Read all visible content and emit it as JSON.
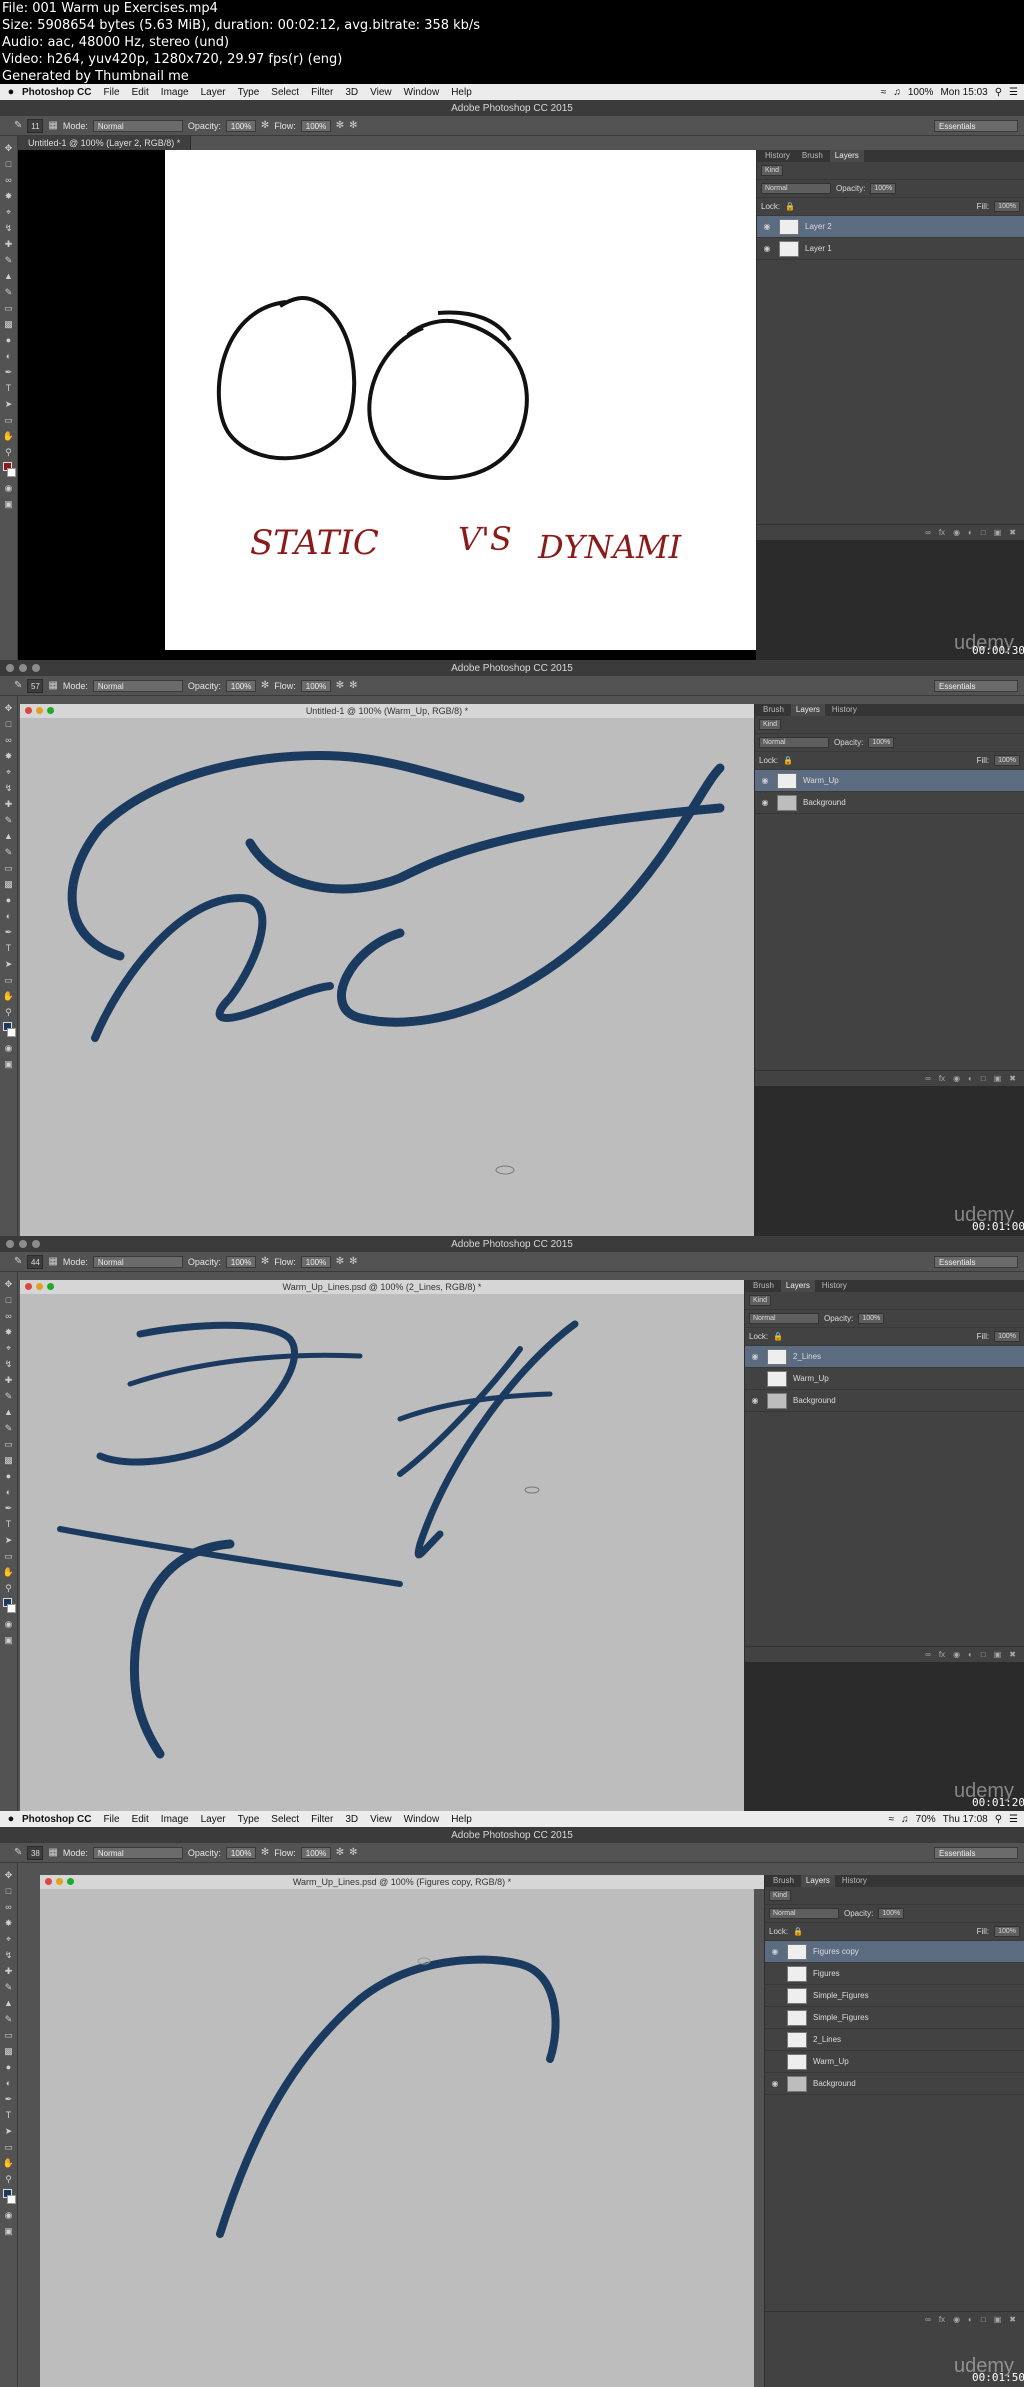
{
  "meta": {
    "file": "File: 001 Warm up Exercises.mp4",
    "size": "Size: 5908654 bytes (5.63 MiB), duration: 00:02:12, avg.bitrate: 358 kb/s",
    "audio": "Audio: aac, 48000 Hz, stereo (und)",
    "video": "Video: h264, yuv420p, 1280x720, 29.97 fps(r) (eng)",
    "generated": "Generated by Thumbnail me"
  },
  "menubar": {
    "app": "Photoshop CC",
    "items": [
      "File",
      "Edit",
      "Image",
      "Layer",
      "Type",
      "Select",
      "Filter",
      "3D",
      "View",
      "Window",
      "Help"
    ],
    "battery1": "100%",
    "clock1": "Mon 15:03",
    "battery4": "70%",
    "clock4": "Thu 17:08"
  },
  "app_title": "Adobe Photoshop CC 2015",
  "options": {
    "mode_label": "Mode:",
    "mode_value": "Normal",
    "opacity_label": "Opacity:",
    "opacity_value": "100%",
    "flow_label": "Flow:",
    "flow_value": "100%",
    "workspace": "Essentials"
  },
  "frames": [
    {
      "brush_size": "11",
      "doc_title": "Untitled-1 @ 100% (Layer 2, RGB/8) *",
      "panel_tabs": [
        "History",
        "Brush",
        "Layers"
      ],
      "layers": [
        "Layer 2",
        "Layer 1"
      ],
      "canvas_text": [
        "STATIC",
        "V'S",
        "DYNAMI"
      ],
      "timestamp": "00:00:30"
    },
    {
      "brush_size": "57",
      "doc_title": "Untitled-1 @ 100% (Warm_Up, RGB/8) *",
      "panel_tabs": [
        "Brush",
        "Layers",
        "History"
      ],
      "layers": [
        "Warm_Up",
        "Background"
      ],
      "timestamp": "00:01:00"
    },
    {
      "brush_size": "44",
      "doc_title": "Warm_Up_Lines.psd @ 100% (2_Lines, RGB/8) *",
      "panel_tabs": [
        "Brush",
        "Layers",
        "History"
      ],
      "layers": [
        "2_Lines",
        "Warm_Up",
        "Background"
      ],
      "timestamp": "00:01:20"
    },
    {
      "brush_size": "38",
      "doc_title": "Warm_Up_Lines.psd @ 100% (Figures copy, RGB/8) *",
      "panel_tabs": [
        "Brush",
        "Layers",
        "History"
      ],
      "layers": [
        "Figures copy",
        "Figures",
        "Simple_Figures",
        "Simple_Figures",
        "2_Lines",
        "Warm_Up",
        "Background"
      ],
      "timestamp": "00:01:50"
    }
  ],
  "layers_panel": {
    "kind": "Kind",
    "blend": "Normal",
    "opacity_label": "Opacity:",
    "opacity_value": "100%",
    "lock_label": "Lock:",
    "fill_label": "Fill:",
    "fill_value": "100%"
  },
  "watermark": "udemy",
  "colors": {
    "ui_gray": "#535353",
    "canvas_gray": "#bdbdbd",
    "ink_blue": "#1b3a5f",
    "ink_red": "#8b1a1a",
    "fg_red": "#8b1a1a",
    "fg_blue": "#1b3a5f",
    "selected_layer": "#5b6b80"
  }
}
